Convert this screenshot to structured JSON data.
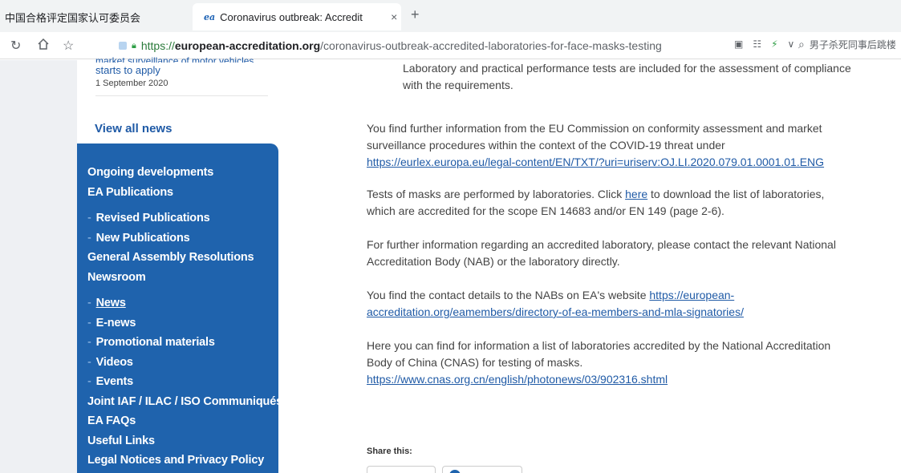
{
  "browser": {
    "tabs": [
      {
        "label": "中国合格评定国家认可委员会"
      },
      {
        "label": "Coronavirus outbreak: Accredit",
        "favicon": "ea"
      }
    ],
    "new_tab": "+",
    "close_tab": "×",
    "url": {
      "scheme": "https://",
      "domain": "european-accreditation.org",
      "path": "/coronavirus-outbreak-accredited-laboratories-for-face-masks-testing"
    },
    "search_text": "男子杀死同事后跳楼"
  },
  "sidebar": {
    "news_teaser": {
      "cut_text": "market surveillance of motor vehicles",
      "link": "starts to apply",
      "date": "1 September 2020"
    },
    "view_all": "View all news",
    "nav": [
      {
        "label": "Ongoing developments",
        "sub": false
      },
      {
        "label": "EA Publications",
        "sub": false
      },
      {
        "label": "Revised Publications",
        "sub": true,
        "gap": true
      },
      {
        "label": "New Publications",
        "sub": true
      },
      {
        "label": "General Assembly Resolutions",
        "sub": false
      },
      {
        "label": "Newsroom",
        "sub": false
      },
      {
        "label": "News",
        "sub": true,
        "gap": true,
        "underline": true
      },
      {
        "label": "E-news",
        "sub": true
      },
      {
        "label": "Promotional materials",
        "sub": true
      },
      {
        "label": "Videos",
        "sub": true
      },
      {
        "label": "Events",
        "sub": true
      },
      {
        "label": "Joint IAF / ILAC / ISO Communiqués",
        "sub": false
      },
      {
        "label": "EA FAQs",
        "sub": false
      },
      {
        "label": "Useful Links",
        "sub": false
      },
      {
        "label": "Legal Notices and Privacy Policy",
        "sub": false
      }
    ]
  },
  "content": {
    "intro": "Laboratory and practical performance tests are included for the assessment of compliance with the requirements.",
    "p1_text": "You find further information from the EU Commission on conformity assessment and market surveillance procedures within the context of the COVID-19 threat under",
    "p1_link": "https://eurlex.europa.eu/legal-content/EN/TXT/?uri=uriserv:OJ.LI.2020.079.01.0001.01.ENG",
    "p2_before": "Tests of masks are performed by laboratories. Click ",
    "p2_link": "here",
    "p2_after": " to download the list of laboratories, which are accredited for the scope EN 14683 and/or EN 149 (page 2-6).",
    "p3": "For further information regarding an accredited laboratory, please contact the relevant National Accreditation Body (NAB) or the laboratory directly.",
    "p4_text": "You find the contact details to the NABs on EA's website ",
    "p4_link": "https://european-accreditation.org/eamembers/directory-of-ea-members-and-mla-signatories/",
    "p5_text": "Here you can find for information a list of laboratories accredited by the National Accreditation Body of China (CNAS) for testing of masks.",
    "p5_link": "https://www.cnas.org.cn/english/photonews/03/902316.shtml",
    "share_label": "Share this:"
  }
}
